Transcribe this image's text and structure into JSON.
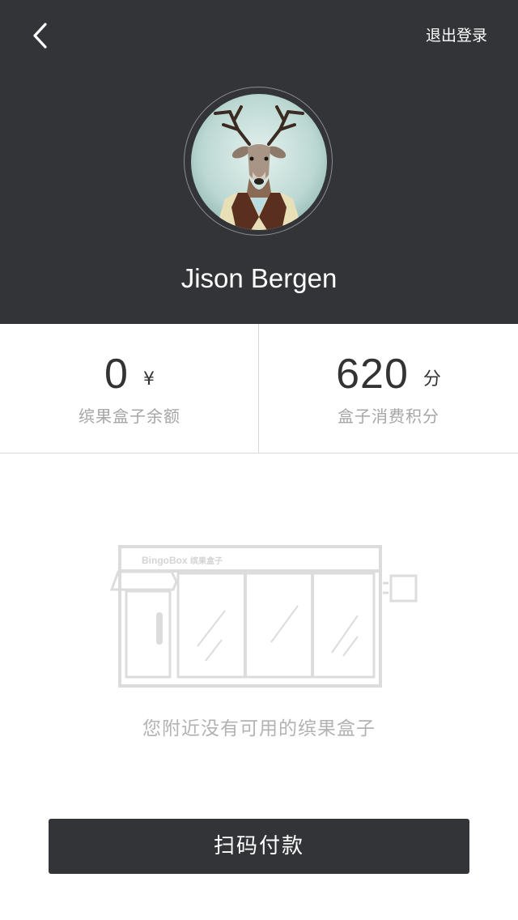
{
  "header": {
    "logout_label": "退出登录",
    "back_icon": "chevron-left-icon",
    "background_color": "#333438"
  },
  "profile": {
    "username": "Jison Bergen",
    "avatar_description_icon": "deer-avatar-icon"
  },
  "stats": {
    "balance": {
      "value": "0",
      "unit": "¥",
      "label": "缤果盒子余额"
    },
    "points": {
      "value": "620",
      "unit": "分",
      "label": "盒子消费积分"
    }
  },
  "empty_state": {
    "machine_brand": "BingoBox",
    "machine_brand_cn": "缤果盒子",
    "message": "您附近没有可用的缤果盒子"
  },
  "actions": {
    "pay_label": "扫码付款"
  }
}
